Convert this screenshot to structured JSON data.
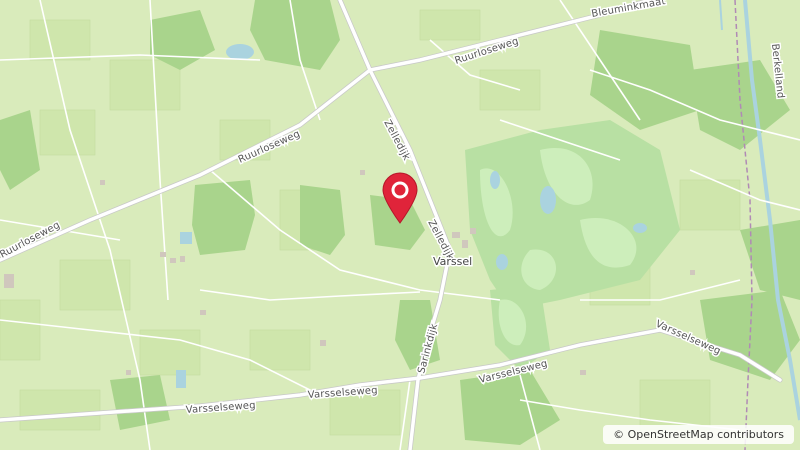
{
  "map": {
    "attribution": "© OpenStreetMap contributors",
    "marker_icon": "map-pin-icon",
    "colors": {
      "farmland": "#d9ebbb",
      "meadow": "#c9e6a4",
      "forest": "#a6d38a",
      "golf": "#bde4a8",
      "water": "#aad3df",
      "road": "#ffffff",
      "marker": "#e0243a"
    },
    "road_labels": {
      "ruurloseweg_1": "Ruurloseweg",
      "ruurloseweg_2": "Ruurloseweg",
      "ruurloseweg_3": "Ruurloseweg",
      "bleuminkmaatweg": "Bleuminkmaat",
      "zelledijk_1": "Zelledijk",
      "zelledijk_2": "Zelledijk",
      "sarinkdijk": "Sarinkdijk",
      "varsselseweg_1": "Varsselseweg",
      "varsselseweg_2": "Varsselseweg",
      "varsselseweg_3": "Varsselseweg",
      "varsselseweg_4": "Varsselseweg",
      "berkelland": "Berkelland"
    },
    "place_labels": {
      "varssel": "Varssel"
    }
  }
}
